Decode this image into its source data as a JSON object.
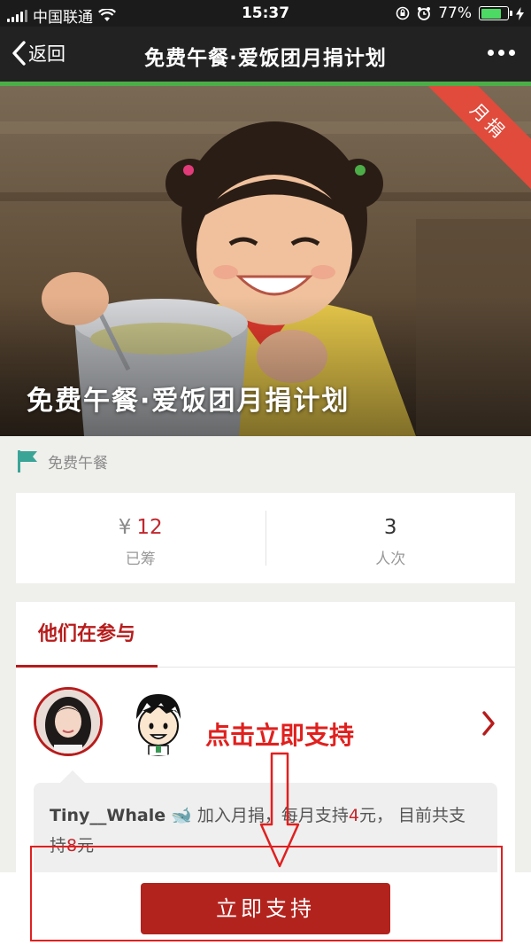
{
  "status_bar": {
    "carrier": "中国联通",
    "time": "15:37",
    "battery_percent": "77%",
    "battery_level": 0.77,
    "icons": [
      "signal-icon",
      "wifi-icon",
      "rotation-lock-icon",
      "alarm-icon",
      "battery-icon",
      "charging-icon"
    ]
  },
  "nav": {
    "back_label": "返回",
    "title": "免费午餐·爱饭团月捐计划",
    "icons": [
      "chevron-left-icon",
      "more-icon"
    ]
  },
  "progress": {
    "value": 1.0,
    "color": "#4cae47"
  },
  "hero": {
    "title": "免费午餐·爱饭团月捐计划",
    "ribbon_label": "月捐"
  },
  "org": {
    "name": "免费午餐",
    "icon": "flag-icon"
  },
  "stats": {
    "raised": {
      "currency": "¥",
      "amount": "12",
      "label": "已筹"
    },
    "count": {
      "value": "3",
      "label": "人次"
    }
  },
  "participants": {
    "tab_label": "他们在参与",
    "feed": {
      "username": "Tiny__Whale",
      "emoji": "🐋",
      "text_before": "加入月捐，每月支持",
      "monthly_amount": "4",
      "text_mid": "元，  目前共支持",
      "total_amount": "8",
      "text_after": "元"
    }
  },
  "annotation": {
    "text": "点击立即支持"
  },
  "support_button": {
    "label": "立即支持"
  },
  "colors": {
    "brand_red": "#b3231e",
    "annotation_red": "#e0201e",
    "accent_green": "#4cae47"
  }
}
